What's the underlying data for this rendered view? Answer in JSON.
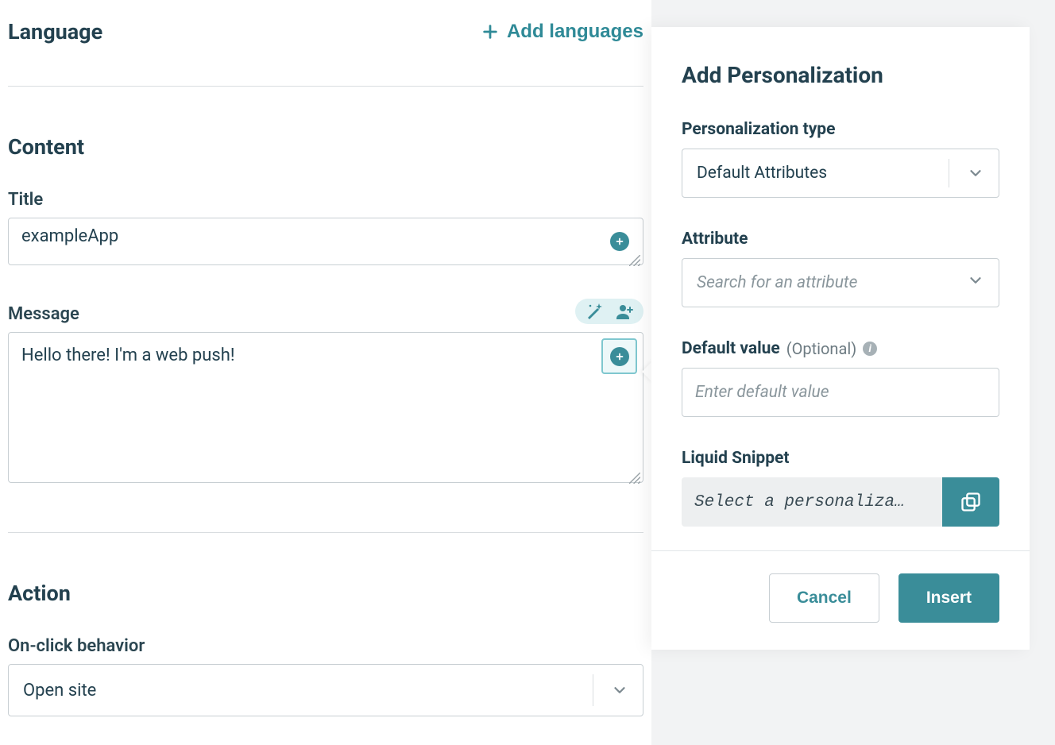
{
  "language": {
    "heading": "Language",
    "add_label": "Add languages"
  },
  "content": {
    "heading": "Content",
    "title_label": "Title",
    "title_value": "exampleApp",
    "message_label": "Message",
    "message_value": "Hello there! I'm a web push!"
  },
  "action": {
    "heading": "Action",
    "onclick_label": "On-click behavior",
    "onclick_value": "Open site"
  },
  "panel": {
    "title": "Add Personalization",
    "type_label": "Personalization type",
    "type_value": "Default Attributes",
    "attribute_label": "Attribute",
    "attribute_placeholder": "Search for an attribute",
    "default_label": "Default value",
    "default_optional": "(Optional)",
    "default_placeholder": "Enter default value",
    "snippet_label": "Liquid Snippet",
    "snippet_placeholder": "Select a personaliza…",
    "cancel_label": "Cancel",
    "insert_label": "Insert"
  }
}
